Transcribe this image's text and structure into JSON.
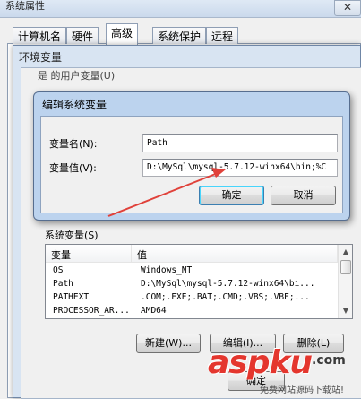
{
  "system_properties": {
    "title": "系统属性",
    "close_glyph": "✕",
    "tabs": [
      "计算机名",
      "硬件",
      "高级",
      "系统保护",
      "远程"
    ],
    "active_tab": "高级"
  },
  "env_dialog": {
    "title": "环境变量",
    "user_vars_label": "是 的用户变量(U)",
    "system_vars_label": "系统变量(S)",
    "columns": [
      "变量",
      "值"
    ],
    "rows": [
      {
        "name": "OS",
        "value": "Windows_NT"
      },
      {
        "name": "Path",
        "value": "D:\\MySql\\mysql-5.7.12-winx64\\bi..."
      },
      {
        "name": "PATHEXT",
        "value": ".COM;.EXE;.BAT;.CMD;.VBS;.VBE;..."
      },
      {
        "name": "PROCESSOR_AR...",
        "value": "AMD64"
      }
    ],
    "new_button": "新建(W)...",
    "edit_button": "编辑(I)...",
    "delete_button": "删除(L)",
    "ok_button": "确定"
  },
  "edit_dialog": {
    "title": "编辑系统变量",
    "name_label": "变量名(N):",
    "name_value": "Path",
    "value_label": "变量值(V):",
    "value_value": "D:\\MySql\\mysql-5.7.12-winx64\\bin;%C",
    "ok_button": "确定",
    "cancel_button": "取消"
  },
  "watermark": {
    "main": "aspku",
    "tld": ".com",
    "sub": "免费网站源码下载站!"
  },
  "colors": {
    "arrow": "#e0413a",
    "default_button_border": "#3c7fb1",
    "watermark_red": "#e4362e"
  }
}
